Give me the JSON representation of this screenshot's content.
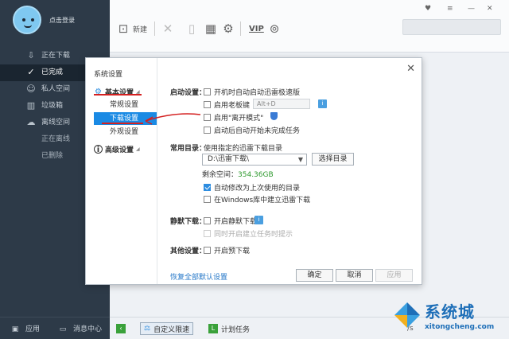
{
  "sidebar": {
    "login": "点击登录",
    "items": [
      {
        "label": "正在下载",
        "icon": "download-icon"
      },
      {
        "label": "已完成",
        "icon": "check-circle-icon"
      },
      {
        "label": "私人空间",
        "icon": "user-lock-icon"
      },
      {
        "label": "垃圾箱",
        "icon": "trash-icon"
      },
      {
        "label": "离线空间",
        "icon": "cloud-icon"
      },
      {
        "label": "正在离线"
      },
      {
        "label": "已删除"
      }
    ],
    "bottom": {
      "apps": "应用",
      "messages": "消息中心"
    }
  },
  "toolbar": {
    "new_label": "新建",
    "vip": "VIP"
  },
  "bottombar": {
    "custom_speed": "自定义限速",
    "scheduled": "计划任务",
    "speed_partial": "/s"
  },
  "dialog": {
    "title": "系统设置",
    "categories": {
      "basic": "基本设置",
      "advanced": "高级设置"
    },
    "subs": [
      "常规设置",
      "下载设置",
      "外观设置"
    ],
    "startup": {
      "label": "启动设置：",
      "opt1": "开机时自动启动迅雷极速版",
      "opt2": "启用老板键",
      "hotkey": "Alt+D",
      "opt3": "启用\"离开模式\"",
      "opt4": "启动后自动开始未完成任务"
    },
    "dirs": {
      "label": "常用目录：",
      "desc": "使用指定的迅雷下载目录",
      "path": "D:\\迅雷下载\\",
      "choose": "选择目录",
      "free_label": "剩余空间：",
      "free_value": "354.36GB",
      "opt1": "自动修改为上次使用的目录",
      "opt2": "在Windows库中建立迅雷下载"
    },
    "silent": {
      "label": "静默下载：",
      "opt1": "开启静默下载",
      "opt2": "同时开启建立任务时提示"
    },
    "other": {
      "label": "其他设置：",
      "opt1": "开启预下载"
    },
    "restore": "恢复全部默认设置",
    "ok": "确定",
    "cancel": "取消",
    "apply": "应用"
  },
  "watermark": {
    "cn": "系统城",
    "url": "xitongcheng.com"
  },
  "colors": {
    "accent": "#1a8ae4",
    "sidebar": "#2d3a48",
    "annotation": "#d42020"
  }
}
